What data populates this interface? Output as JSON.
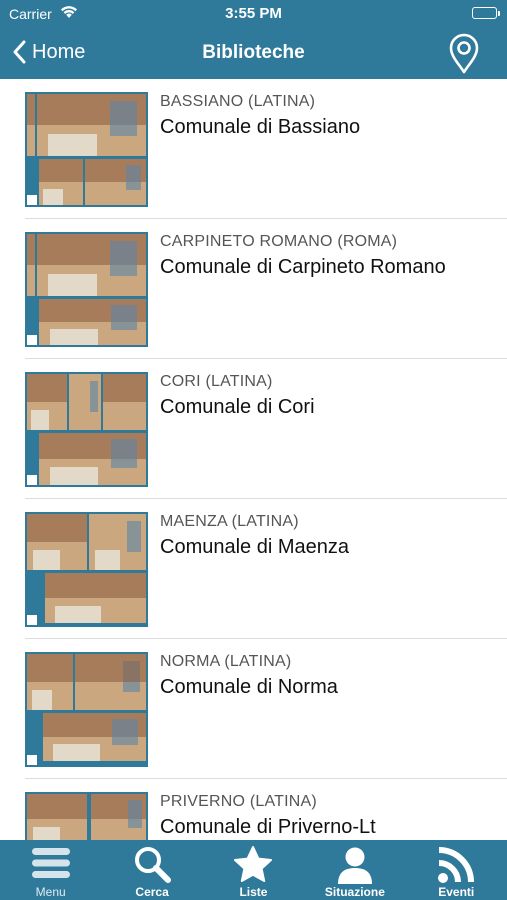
{
  "status_bar": {
    "carrier": "Carrier",
    "time": "3:55 PM"
  },
  "nav": {
    "back_label": "Home",
    "title": "Biblioteche"
  },
  "libraries": [
    {
      "region": "BASSIANO (LATINA)",
      "name": "Comunale di Bassiano"
    },
    {
      "region": "CARPINETO ROMANO (ROMA)",
      "name": "Comunale di Carpineto Romano"
    },
    {
      "region": "CORI (LATINA)",
      "name": "Comunale di Cori"
    },
    {
      "region": "MAENZA (LATINA)",
      "name": "Comunale di Maenza"
    },
    {
      "region": "NORMA (LATINA)",
      "name": "Comunale di Norma"
    },
    {
      "region": "PRIVERNO (LATINA)",
      "name": "Comunale di Priverno-Lt"
    }
  ],
  "tabbar": {
    "menu": "Menu",
    "search": "Cerca",
    "lists": "Liste",
    "status": "Situazione",
    "events": "Eventi"
  },
  "colors": {
    "brand": "#2f7a9a",
    "separator": "#dcdcdc"
  }
}
